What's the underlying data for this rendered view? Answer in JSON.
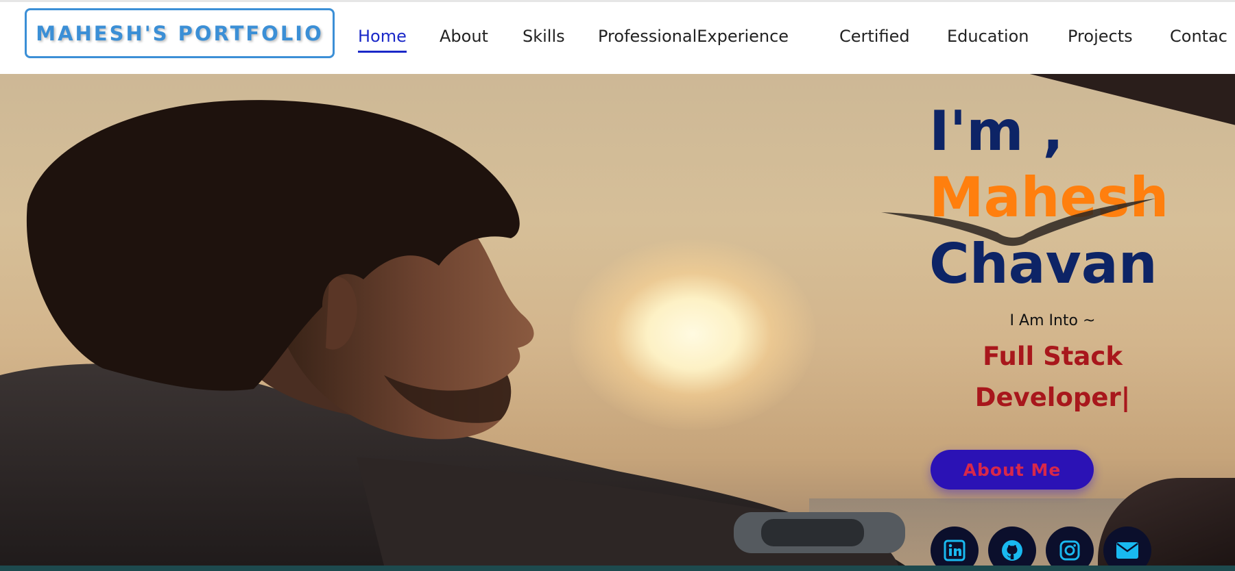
{
  "header": {
    "logo": "MAHESH'S PORTFOLIO",
    "nav": [
      {
        "label": "Home",
        "active": true
      },
      {
        "label": "About"
      },
      {
        "label": "Skills"
      },
      {
        "label": "ProfessionalExperience"
      },
      {
        "label": "Certified"
      },
      {
        "label": "Education"
      },
      {
        "label": "Projects"
      },
      {
        "label": "Contac"
      }
    ]
  },
  "hero": {
    "greeting": "I'm ,",
    "first_name": "Mahesh",
    "last_name": "Chavan",
    "into_label": "I Am Into ~",
    "role_line1": "Full Stack",
    "role_line2": "Developer|",
    "about_button": "About Me",
    "socials": [
      {
        "icon": "linkedin-icon"
      },
      {
        "icon": "github-icon"
      },
      {
        "icon": "instagram-icon"
      },
      {
        "icon": "mail-icon"
      }
    ]
  },
  "colors": {
    "accent": "#1a28c8",
    "name_highlight": "#ff7f0e",
    "name_dark": "#0d2466",
    "role": "#a8171c",
    "button_bg": "#2b12b5",
    "button_text": "#d8284a",
    "logo_border": "#3b8fd6",
    "icon_color": "#19b9f0"
  }
}
